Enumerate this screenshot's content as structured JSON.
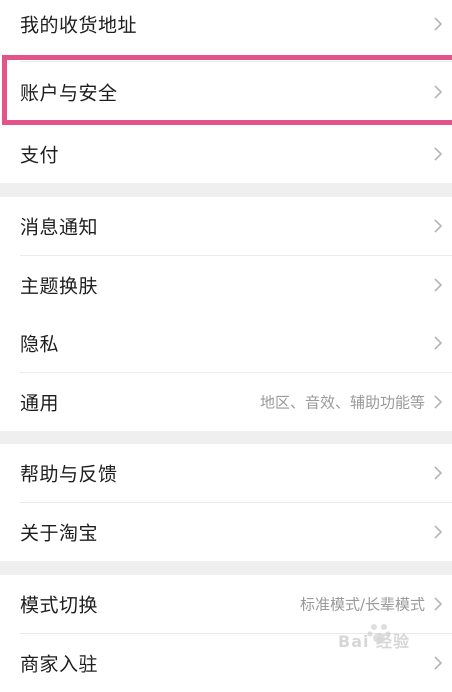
{
  "settings": {
    "rows": [
      {
        "label": "我的收货地址"
      },
      {
        "label": "账户与安全"
      },
      {
        "label": "支付"
      },
      {
        "label": "消息通知"
      },
      {
        "label": "主题换肤"
      },
      {
        "label": "隐私"
      },
      {
        "label": "通用",
        "hint": "地区、音效、辅助功能等"
      },
      {
        "label": "帮助与反馈"
      },
      {
        "label": "关于淘宝"
      },
      {
        "label": "模式切换",
        "hint": "标准模式/长辈模式"
      },
      {
        "label": "商家入驻"
      }
    ]
  },
  "highlight": {
    "color": "#e3558a",
    "target": "账户与安全"
  },
  "watermark": {
    "text": "Bai 经验"
  }
}
